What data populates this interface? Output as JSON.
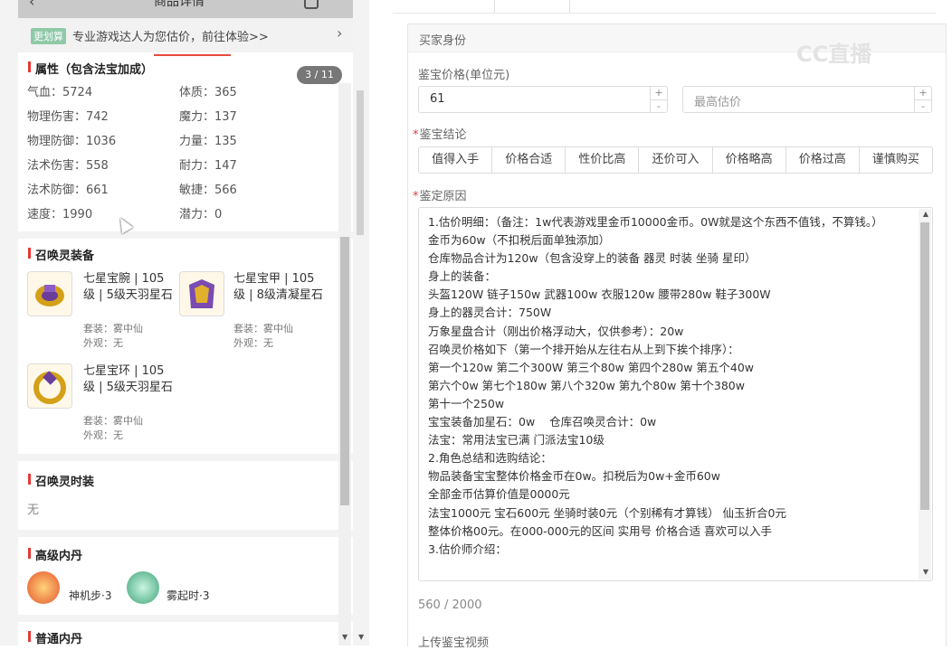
{
  "left": {
    "title": "商品详情",
    "promo": {
      "tag": "更划算",
      "text": "专业游戏达人为您估价，前往体验>>"
    },
    "pager": "3 / 11",
    "attributes": {
      "title": "属性（包含法宝加成）",
      "items": [
        "气血：5724",
        "体质：365",
        "物理伤害：742",
        "魔力：137",
        "物理防御：1036",
        "力量：135",
        "法术伤害：558",
        "耐力：147",
        "法术防御：661",
        "敏捷：566",
        "速度：1990",
        "潜力：0"
      ]
    },
    "equipment": {
      "title": "召唤灵装备",
      "items": [
        {
          "name": "七星宝腕 | 105级 | 5级天羽星石",
          "set": "套装：雾中仙",
          "look": "外观：无"
        },
        {
          "name": "七星宝甲 | 105级 | 8级清凝星石",
          "set": "套装：雾中仙",
          "look": "外观：无"
        },
        {
          "name": "七星宝环 | 105级 | 5级天羽星石",
          "set": "套装：雾中仙",
          "look": "外观：无"
        }
      ]
    },
    "fashion": {
      "title": "召唤灵时装",
      "value": "无"
    },
    "advanced_dan": {
      "title": "高级内丹",
      "items": [
        "神机步·3",
        "雾起时·3"
      ]
    },
    "normal_dan": {
      "title": "普通内丹"
    }
  },
  "right": {
    "section_title": "买家身份",
    "price_label": "鉴宝价格(单位元)",
    "price_value": "61",
    "max_price_placeholder": "最高估价",
    "conclusion_label": "鉴宝结论",
    "conclusion_options": [
      "值得入手",
      "价格合适",
      "性价比高",
      "还价可入",
      "价格略高",
      "价格过高",
      "谨慎购买"
    ],
    "reason_label": "鉴定原因",
    "reason_text": "1.估价明细：（备注：1w代表游戏里金币10000金币。0W就是这个东西不值钱，不算钱。）\n金币为60w（不扣税后面单独添加）\n仓库物品合计为120w（包含没穿上的装备 器灵 时装 坐骑 星印）\n身上的装备：\n头盔120W 链子150w 武器100w 衣服120w 腰带280w 鞋子300W\n身上的器灵合计：750W\n万象星盘合计（刚出价格浮动大，仅供参考）：20w\n召唤灵价格如下（第一个排开始从左往右从上到下挨个排序）：\n第一个120w 第二个300W 第三个80w 第四个280w 第五个40w\n第六个0w 第七个180w 第八个320w 第九个80w 第十个380w\n第十一个250w\n宝宝装备加星石：0w    仓库召唤灵合计：0w\n法宝：常用法宝已满 门派法宝10级\n2.角色总结和选购结论：\n物品装备宝宝整体价格金币在0w。扣税后为0w+金币60w\n全部金币估算价值是0000元\n法宝1000元 宝石600元 坐骑时装0元（个别稀有才算钱） 仙玉折合0元\n整体价格00元。在000-000元的区间 实用号 价格合适 喜欢可以入手\n3.估价师介绍：",
    "counter": "560 / 2000",
    "upload_label": "上传鉴宝视频",
    "watermark": "CC直播"
  }
}
